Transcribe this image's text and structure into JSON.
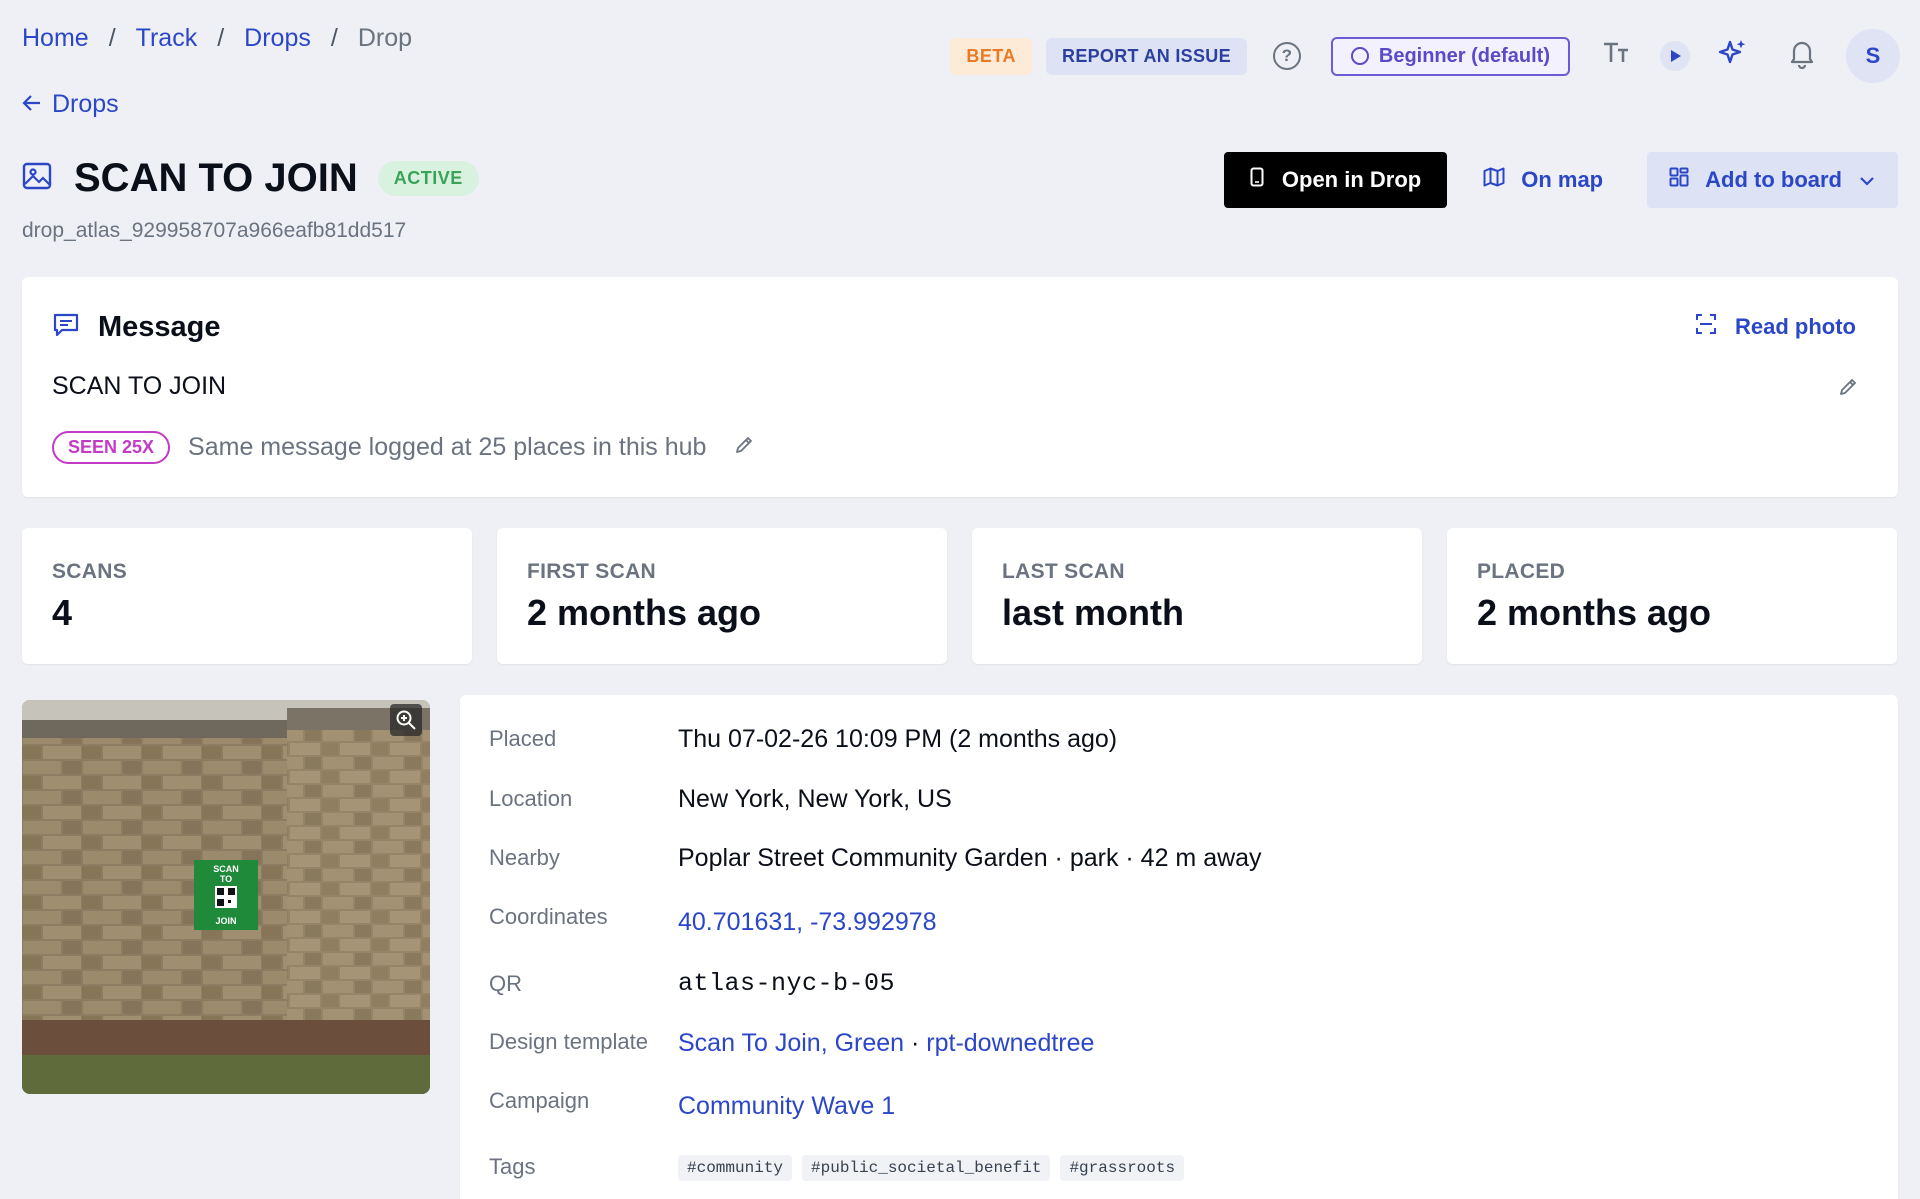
{
  "breadcrumb": {
    "home": "Home",
    "track": "Track",
    "drops": "Drops",
    "current": "Drop",
    "separator": "/"
  },
  "topbar": {
    "beta": "BETA",
    "report": "REPORT AN ISSUE",
    "help": "?",
    "level": "Beginner (default)",
    "textsize": "TT",
    "avatar_initial": "S"
  },
  "back_link": "Drops",
  "drop": {
    "title": "SCAN TO JOIN",
    "status": "ACTIVE",
    "id": "drop_atlas_929958707a966eafb81dd517"
  },
  "actions": {
    "open": "Open in Drop",
    "map": "On map",
    "board": "Add to board"
  },
  "message": {
    "heading": "Message",
    "read_photo": "Read photo",
    "text": "SCAN TO JOIN",
    "seen_badge": "SEEN 25X",
    "seen_text": "Same message logged at 25 places in this hub"
  },
  "stats": [
    {
      "label": "SCANS",
      "value": "4"
    },
    {
      "label": "FIRST SCAN",
      "value": "2 months ago"
    },
    {
      "label": "LAST SCAN",
      "value": "last month"
    },
    {
      "label": "PLACED",
      "value": "2 months ago"
    }
  ],
  "photo": {
    "sign_line1": "SCAN",
    "sign_line2": "TO",
    "sign_line3": "JOIN"
  },
  "details": {
    "placed_label": "Placed",
    "placed_value": "Thu 07-02-26 10:09 PM (2 months ago)",
    "location_label": "Location",
    "location_value": "New York, New York, US",
    "nearby_label": "Nearby",
    "nearby_value": "Poplar Street Community Garden · park · 42 m away",
    "coords_label": "Coordinates",
    "coords_value": "40.701631, -73.992978",
    "qr_label": "QR",
    "qr_value": "atlas-nyc-b-05",
    "design_label": "Design template",
    "design_name": "Scan To Join, Green",
    "design_sep": " · ",
    "design_code": "rpt-downedtree",
    "campaign_label": "Campaign",
    "campaign_value": "Community Wave 1",
    "tags_label": "Tags",
    "tags": [
      "#community",
      "#public_societal_benefit",
      "#grassroots"
    ]
  },
  "colors": {
    "accent": "#2b47c8",
    "page_bg": "#eef0f5",
    "active_green": "#3aa35a",
    "beta_orange": "#ea7a26",
    "seen_magenta": "#c23ac5",
    "level_purple": "#5a49c9"
  }
}
